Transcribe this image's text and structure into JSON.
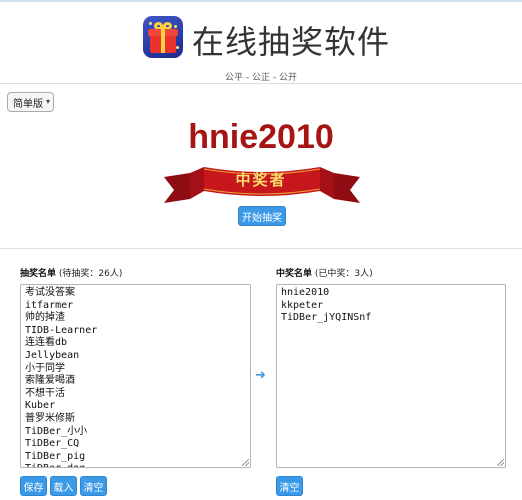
{
  "header": {
    "app_title": "在线抽奖软件",
    "slogan": "公平 - 公正 - 公开",
    "logo_icon": "gift-box-icon"
  },
  "version_select": {
    "selected": "简单版"
  },
  "result": {
    "winner": "hnie2010",
    "banner_label": "中奖者"
  },
  "actions": {
    "start_label": "开始抽奖"
  },
  "candidates": {
    "title": "抽奖名单",
    "status": "(待抽奖：26人)",
    "names": [
      "考试没答案",
      "itfarmer",
      "帅的掉渣",
      "TIDB-Learner",
      "连连看db",
      "Jellybean",
      "小于同学",
      "索隆爱喝酒",
      "不想干活",
      "Kuber",
      "普罗米修斯",
      "TiDBer_小小",
      "TiDBer_CQ",
      "TiDBer_pig",
      "TiDBer_dog"
    ],
    "save_label": "保存",
    "load_label": "载入",
    "clear_label": "清空"
  },
  "winners": {
    "title": "中奖名单",
    "status": "(已中奖：3人)",
    "names": [
      "hnie2010",
      "kkpeter",
      "TiDBer_jYQINSnf"
    ],
    "clear_label": "清空"
  },
  "colors": {
    "accent": "#3b9ae8",
    "winner_text": "#a61414",
    "banner_red": "#c8161d",
    "banner_gold": "#f7dd6a"
  }
}
